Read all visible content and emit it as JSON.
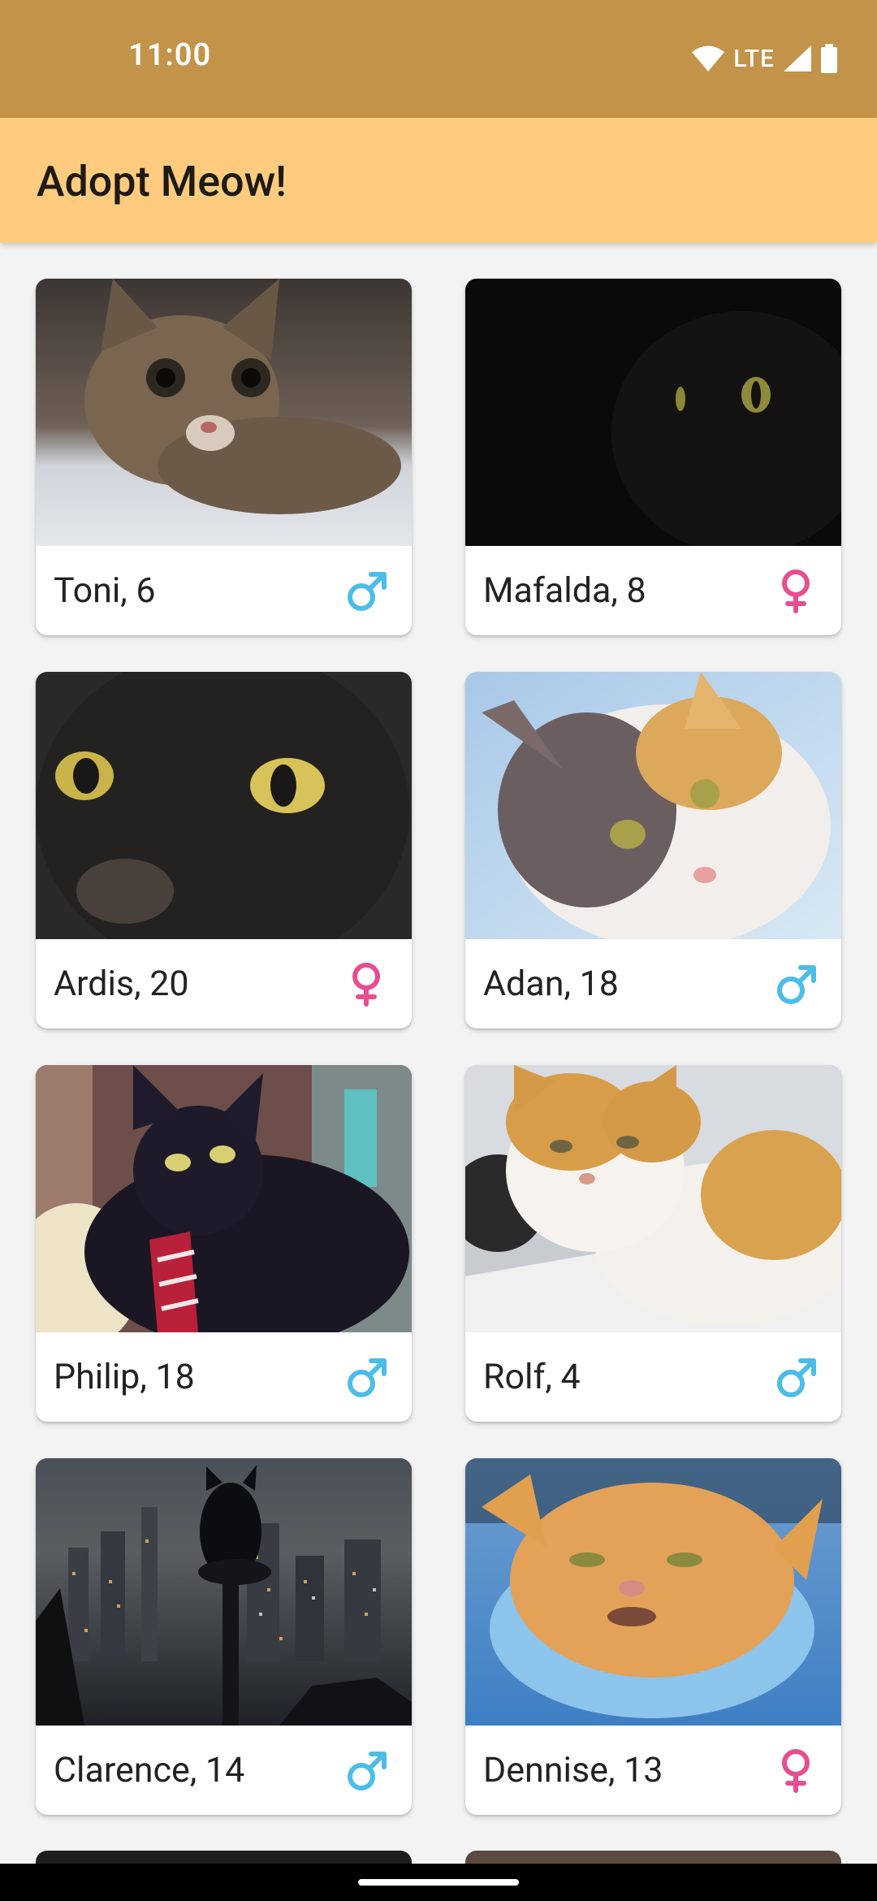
{
  "status_bar": {
    "time": "11:00",
    "network": "LTE"
  },
  "app_bar": {
    "title": "Adopt Meow!"
  },
  "colors": {
    "male": "#4bbde8",
    "female": "#e64f8f",
    "status_bar": "#c39349",
    "app_bar": "#ffcc7f"
  },
  "cats": [
    {
      "label": "Toni, 6",
      "gender": "male"
    },
    {
      "label": "Mafalda, 8",
      "gender": "female"
    },
    {
      "label": "Ardis, 20",
      "gender": "female"
    },
    {
      "label": "Adan, 18",
      "gender": "male"
    },
    {
      "label": "Philip, 18",
      "gender": "male"
    },
    {
      "label": "Rolf, 4",
      "gender": "male"
    },
    {
      "label": "Clarence, 14",
      "gender": "male"
    },
    {
      "label": "Dennise, 13",
      "gender": "female"
    }
  ]
}
